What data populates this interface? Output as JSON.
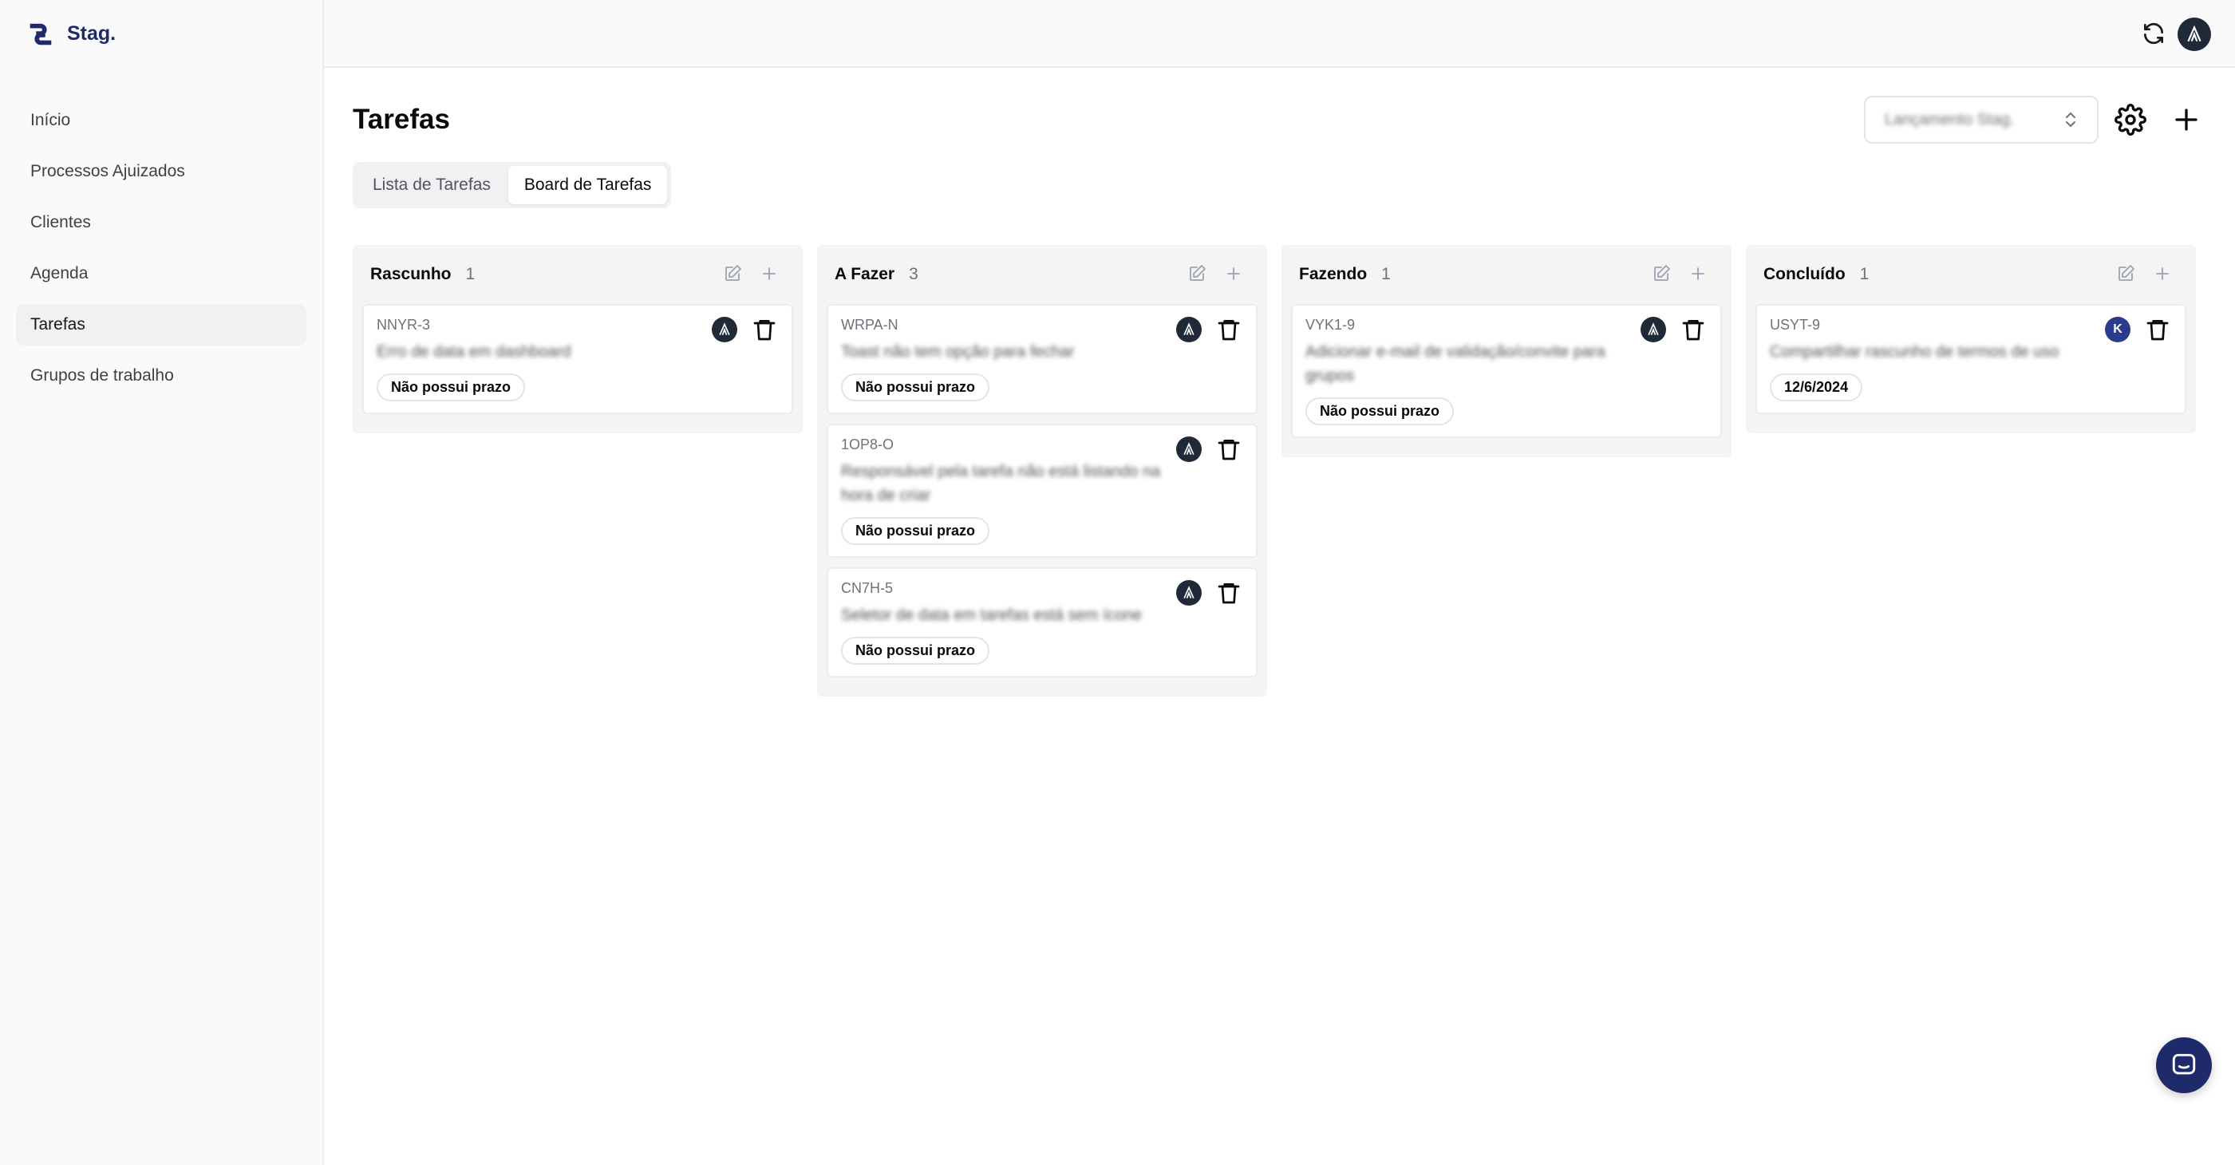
{
  "brand": {
    "name": "Stag."
  },
  "sidebar": {
    "items": [
      {
        "label": "Início",
        "active": false
      },
      {
        "label": "Processos Ajuizados",
        "active": false
      },
      {
        "label": "Clientes",
        "active": false
      },
      {
        "label": "Agenda",
        "active": false
      },
      {
        "label": "Tarefas",
        "active": true
      },
      {
        "label": "Grupos de trabalho",
        "active": false
      }
    ]
  },
  "page": {
    "title": "Tarefas",
    "project_select": "Lançamento Stag."
  },
  "tabs": [
    {
      "label": "Lista de Tarefas",
      "active": false
    },
    {
      "label": "Board de Tarefas",
      "active": true
    }
  ],
  "board": {
    "columns": [
      {
        "title": "Rascunho",
        "count": "1",
        "cards": [
          {
            "code": "NNYR-3",
            "title": "Erro de data em dashboard",
            "due": "Não possui prazo"
          }
        ]
      },
      {
        "title": "A Fazer",
        "count": "3",
        "cards": [
          {
            "code": "WRPA-N",
            "title": "Toast não tem opção para fechar",
            "due": "Não possui prazo"
          },
          {
            "code": "1OP8-O",
            "title": "Responsável pela tarefa não está listando na hora de criar",
            "due": "Não possui prazo"
          },
          {
            "code": "CN7H-5",
            "title": "Seletor de data em tarefas está sem ícone",
            "due": "Não possui prazo"
          }
        ]
      },
      {
        "title": "Fazendo",
        "count": "1",
        "cards": [
          {
            "code": "VYK1-9",
            "title": "Adicionar e-mail de validação/convite para grupos",
            "due": "Não possui prazo"
          }
        ]
      },
      {
        "title": "Concluído",
        "count": "1",
        "cards": [
          {
            "code": "USYT-9",
            "title": "Compartilhar rascunho de termos de uso",
            "due": "12/6/2024",
            "avatar_letter": "K"
          }
        ]
      }
    ]
  },
  "colors": {
    "brand": "#1f2a6b",
    "avatar_dark": "#1f2937",
    "avatar_blue": "#2a3a8c"
  }
}
